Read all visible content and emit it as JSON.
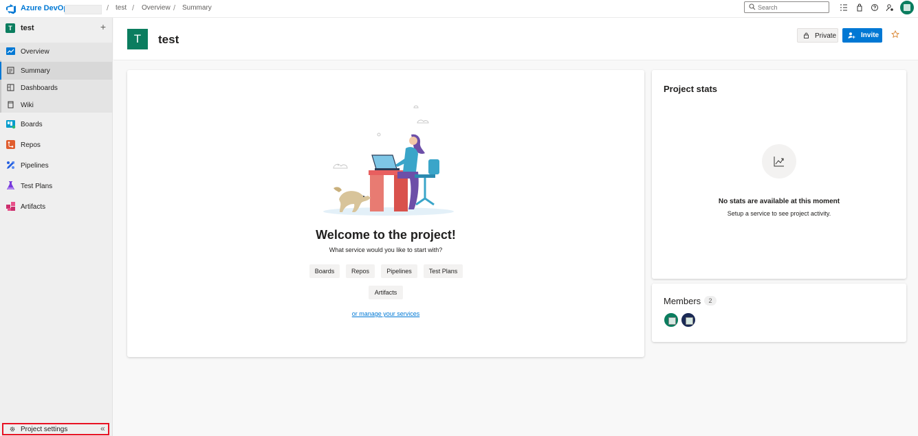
{
  "topbar": {
    "brand": "Azure DevOps",
    "breadcrumb": [
      "test",
      "Overview",
      "Summary"
    ],
    "search_placeholder": "Search"
  },
  "sidebar": {
    "project_initial": "T",
    "project_name": "test",
    "items": [
      {
        "label": "Overview",
        "icon": "overview-icon"
      },
      {
        "label": "Summary",
        "icon": "summary-icon"
      },
      {
        "label": "Dashboards",
        "icon": "dashboards-icon"
      },
      {
        "label": "Wiki",
        "icon": "wiki-icon"
      },
      {
        "label": "Boards",
        "icon": "boards-icon"
      },
      {
        "label": "Repos",
        "icon": "repos-icon"
      },
      {
        "label": "Pipelines",
        "icon": "pipelines-icon"
      },
      {
        "label": "Test Plans",
        "icon": "test-plans-icon"
      },
      {
        "label": "Artifacts",
        "icon": "artifacts-icon"
      }
    ],
    "settings_label": "Project settings",
    "collapse_glyph": "«"
  },
  "header": {
    "initial": "T",
    "title": "test",
    "private_label": "Private",
    "invite_label": "Invite"
  },
  "welcome": {
    "title": "Welcome to the project!",
    "subtitle": "What service would you like to start with?",
    "services": [
      "Boards",
      "Repos",
      "Pipelines",
      "Test Plans",
      "Artifacts"
    ],
    "manage_link": "or manage your services"
  },
  "stats": {
    "title": "Project stats",
    "empty_title": "No stats are available at this moment",
    "empty_hint": "Setup a service to see project activity."
  },
  "members": {
    "title": "Members",
    "count": "2"
  },
  "colors": {
    "accent": "#0078d4",
    "project_tile": "#0b7d5f",
    "highlight_border": "#e81123"
  }
}
